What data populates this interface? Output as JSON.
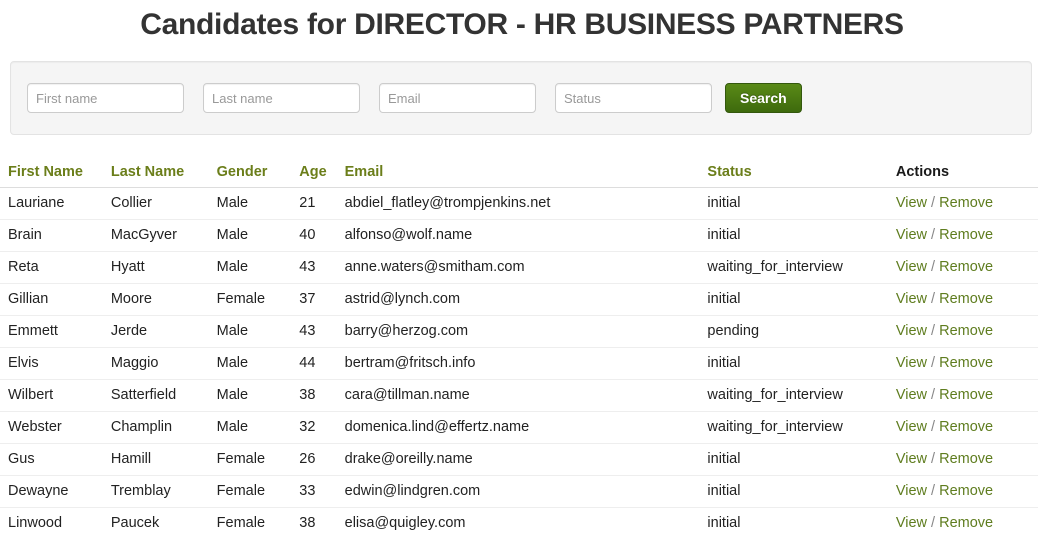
{
  "page_title": "Candidates for DIRECTOR - HR BUSINESS PARTNERS",
  "search": {
    "first_name_placeholder": "First name",
    "first_name_value": "",
    "last_name_placeholder": "Last name",
    "last_name_value": "",
    "email_placeholder": "Email",
    "email_value": "",
    "status_placeholder": "Status",
    "status_value": "",
    "search_button_label": "Search"
  },
  "table": {
    "headers": {
      "first_name": "First Name",
      "last_name": "Last Name",
      "gender": "Gender",
      "age": "Age",
      "email": "Email",
      "status": "Status",
      "actions": "Actions"
    },
    "action_labels": {
      "view": "View",
      "separator": "/",
      "remove": "Remove"
    },
    "rows": [
      {
        "first_name": "Lauriane",
        "last_name": "Collier",
        "gender": "Male",
        "age": "21",
        "email": "abdiel_flatley@trompjenkins.net",
        "status": "initial"
      },
      {
        "first_name": "Brain",
        "last_name": "MacGyver",
        "gender": "Male",
        "age": "40",
        "email": "alfonso@wolf.name",
        "status": "initial"
      },
      {
        "first_name": "Reta",
        "last_name": "Hyatt",
        "gender": "Male",
        "age": "43",
        "email": "anne.waters@smitham.com",
        "status": "waiting_for_interview"
      },
      {
        "first_name": "Gillian",
        "last_name": "Moore",
        "gender": "Female",
        "age": "37",
        "email": "astrid@lynch.com",
        "status": "initial"
      },
      {
        "first_name": "Emmett",
        "last_name": "Jerde",
        "gender": "Male",
        "age": "43",
        "email": "barry@herzog.com",
        "status": "pending"
      },
      {
        "first_name": "Elvis",
        "last_name": "Maggio",
        "gender": "Male",
        "age": "44",
        "email": "bertram@fritsch.info",
        "status": "initial"
      },
      {
        "first_name": "Wilbert",
        "last_name": "Satterfield",
        "gender": "Male",
        "age": "38",
        "email": "cara@tillman.name",
        "status": "waiting_for_interview"
      },
      {
        "first_name": "Webster",
        "last_name": "Champlin",
        "gender": "Male",
        "age": "32",
        "email": "domenica.lind@effertz.name",
        "status": "waiting_for_interview"
      },
      {
        "first_name": "Gus",
        "last_name": "Hamill",
        "gender": "Female",
        "age": "26",
        "email": "drake@oreilly.name",
        "status": "initial"
      },
      {
        "first_name": "Dewayne",
        "last_name": "Tremblay",
        "gender": "Female",
        "age": "33",
        "email": "edwin@lindgren.com",
        "status": "initial"
      },
      {
        "first_name": "Linwood",
        "last_name": "Paucek",
        "gender": "Female",
        "age": "38",
        "email": "elisa@quigley.com",
        "status": "initial"
      }
    ]
  },
  "colors": {
    "header_green": "#6b7e1a",
    "link_green": "#5f7d1f",
    "button_green": "#4b7d16",
    "title_dark": "#333333",
    "panel_bg": "#f5f5f5"
  }
}
